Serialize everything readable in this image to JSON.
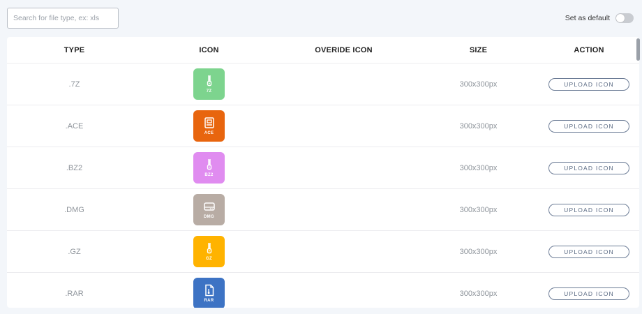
{
  "search": {
    "placeholder": "Search for file type, ex: xls",
    "value": ""
  },
  "set_default": {
    "label": "Set as default",
    "enabled": false
  },
  "table": {
    "headers": [
      "TYPE",
      "ICON",
      "OVERIDE ICON",
      "SIZE",
      "ACTION"
    ],
    "rows": [
      {
        "type": ".7Z",
        "icon_label": "7Z",
        "icon_color": "#7dd48e",
        "icon": "zip-icon",
        "size": "300x300px",
        "action": "UPLOAD ICON"
      },
      {
        "type": ".ACE",
        "icon_label": "ACE",
        "icon_color": "#e8650e",
        "icon": "archive-icon",
        "size": "300x300px",
        "action": "UPLOAD ICON"
      },
      {
        "type": ".BZ2",
        "icon_label": "BZ2",
        "icon_color": "#e08cf0",
        "icon": "zip-icon",
        "size": "300x300px",
        "action": "UPLOAD ICON"
      },
      {
        "type": ".DMG",
        "icon_label": "DMG",
        "icon_color": "#b8aca4",
        "icon": "disk-drive-icon",
        "size": "300x300px",
        "action": "UPLOAD ICON"
      },
      {
        "type": ".GZ",
        "icon_label": "GZ",
        "icon_color": "#ffb300",
        "icon": "zip-icon",
        "size": "300x300px",
        "action": "UPLOAD ICON"
      },
      {
        "type": ".RAR",
        "icon_label": "RAR",
        "icon_color": "#3d73c4",
        "icon": "archive-file-icon",
        "size": "300x300px",
        "action": "UPLOAD ICON"
      }
    ]
  }
}
